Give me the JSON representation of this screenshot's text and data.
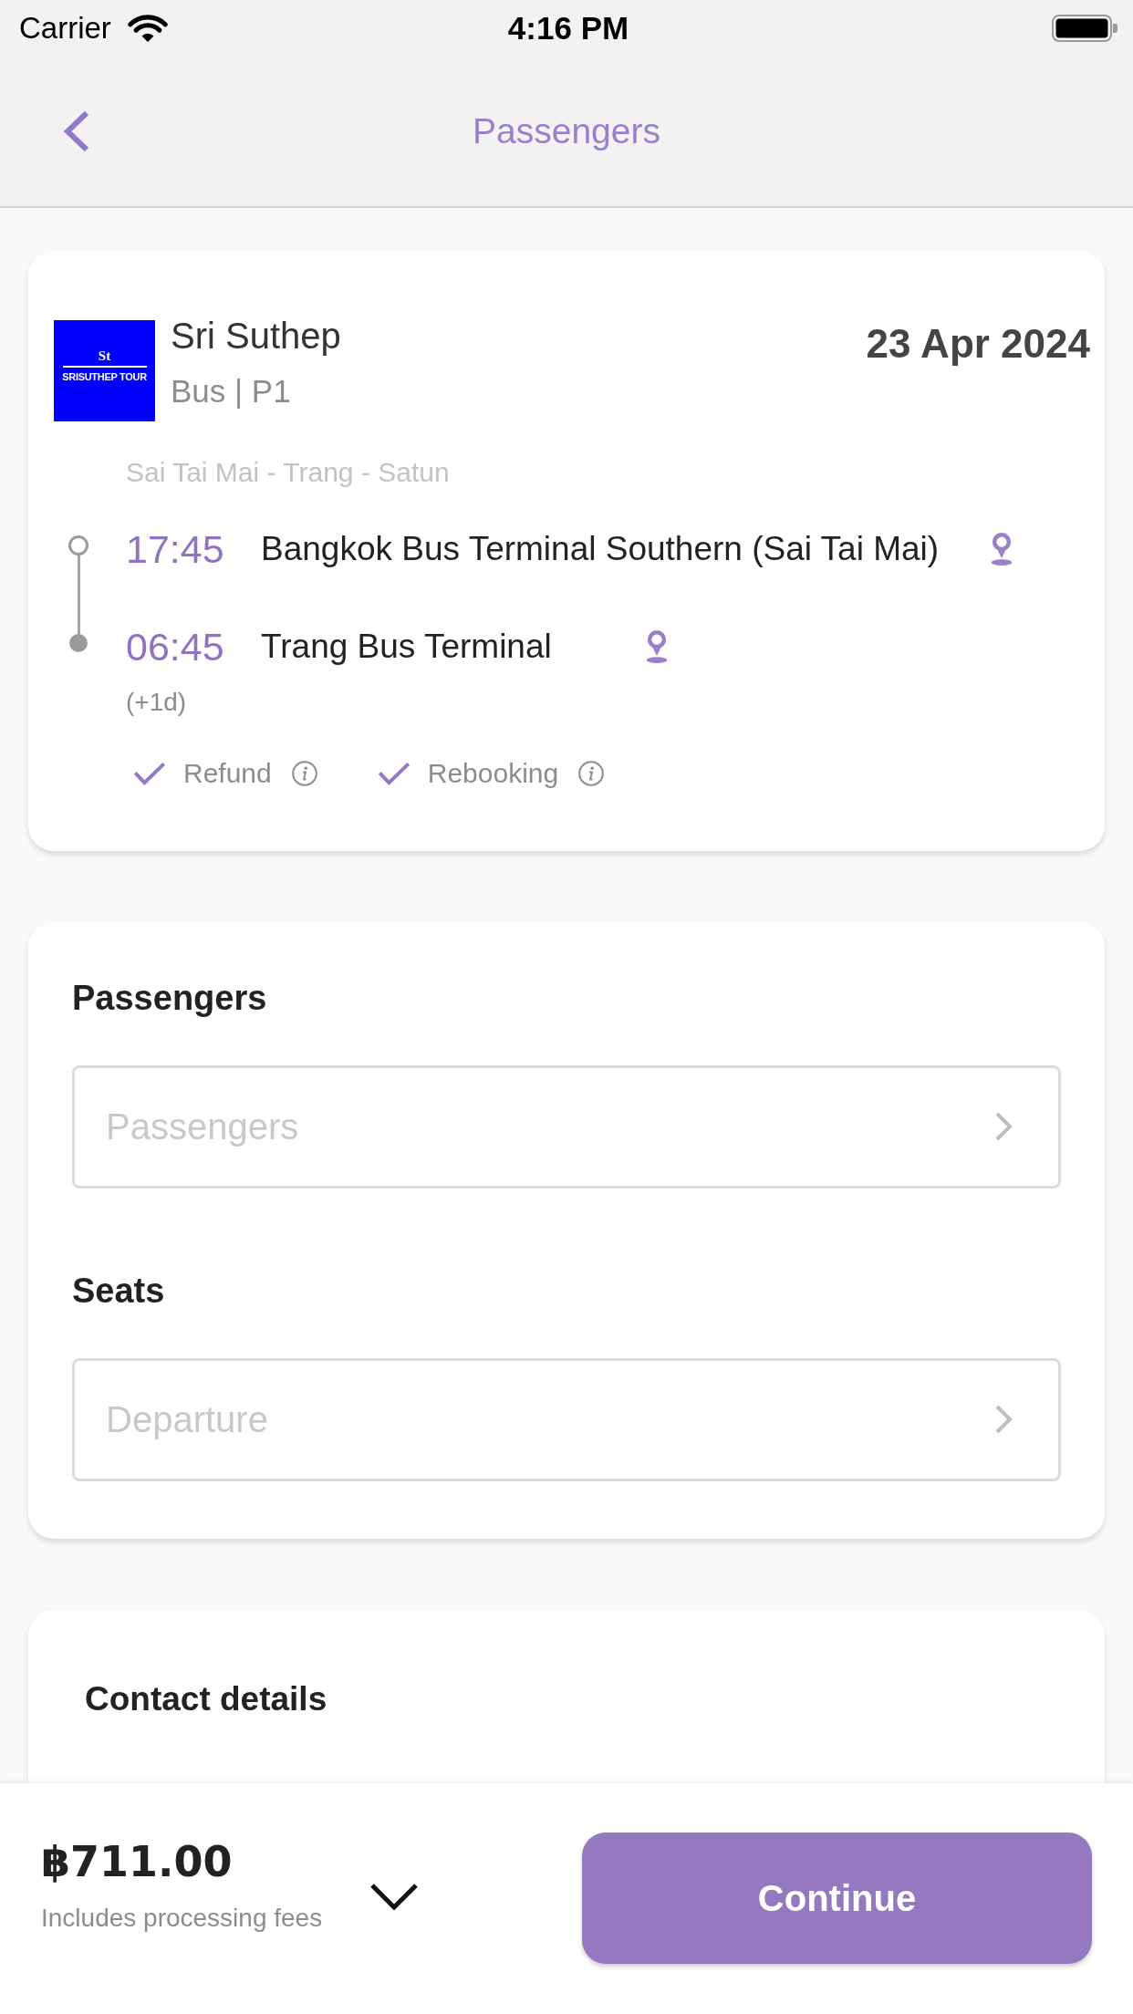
{
  "status_bar": {
    "carrier": "Carrier",
    "time": "4:16 PM"
  },
  "nav_bar": {
    "title": "Passengers"
  },
  "trip_card": {
    "logo": {
      "monogram": "St",
      "wordmark": "SRISUTHEP TOUR"
    },
    "operator": "Sri Suthep",
    "vehicle": "Bus | P1",
    "date": "23 Apr 2024",
    "route": "Sai Tai Mai - Trang - Satun",
    "stops": [
      {
        "kind": "departure",
        "time": "17:45",
        "station": "Bangkok Bus Terminal Southern (Sai Tai Mai)"
      },
      {
        "kind": "arrival",
        "time": "06:45",
        "day_offset": "(+1d)",
        "station": "Trang Bus Terminal"
      }
    ],
    "features": [
      {
        "label": "Refund",
        "included": true
      },
      {
        "label": "Rebooking",
        "included": true
      }
    ]
  },
  "passengers_card": {
    "sections": [
      {
        "heading": "Passengers",
        "placeholder": "Passengers"
      },
      {
        "heading": "Seats",
        "placeholder": "Departure"
      }
    ]
  },
  "contact_card": {
    "heading": "Contact details"
  },
  "footer": {
    "price": "฿711.00",
    "note": "Includes processing fees",
    "expanded": false,
    "button": "Continue"
  }
}
